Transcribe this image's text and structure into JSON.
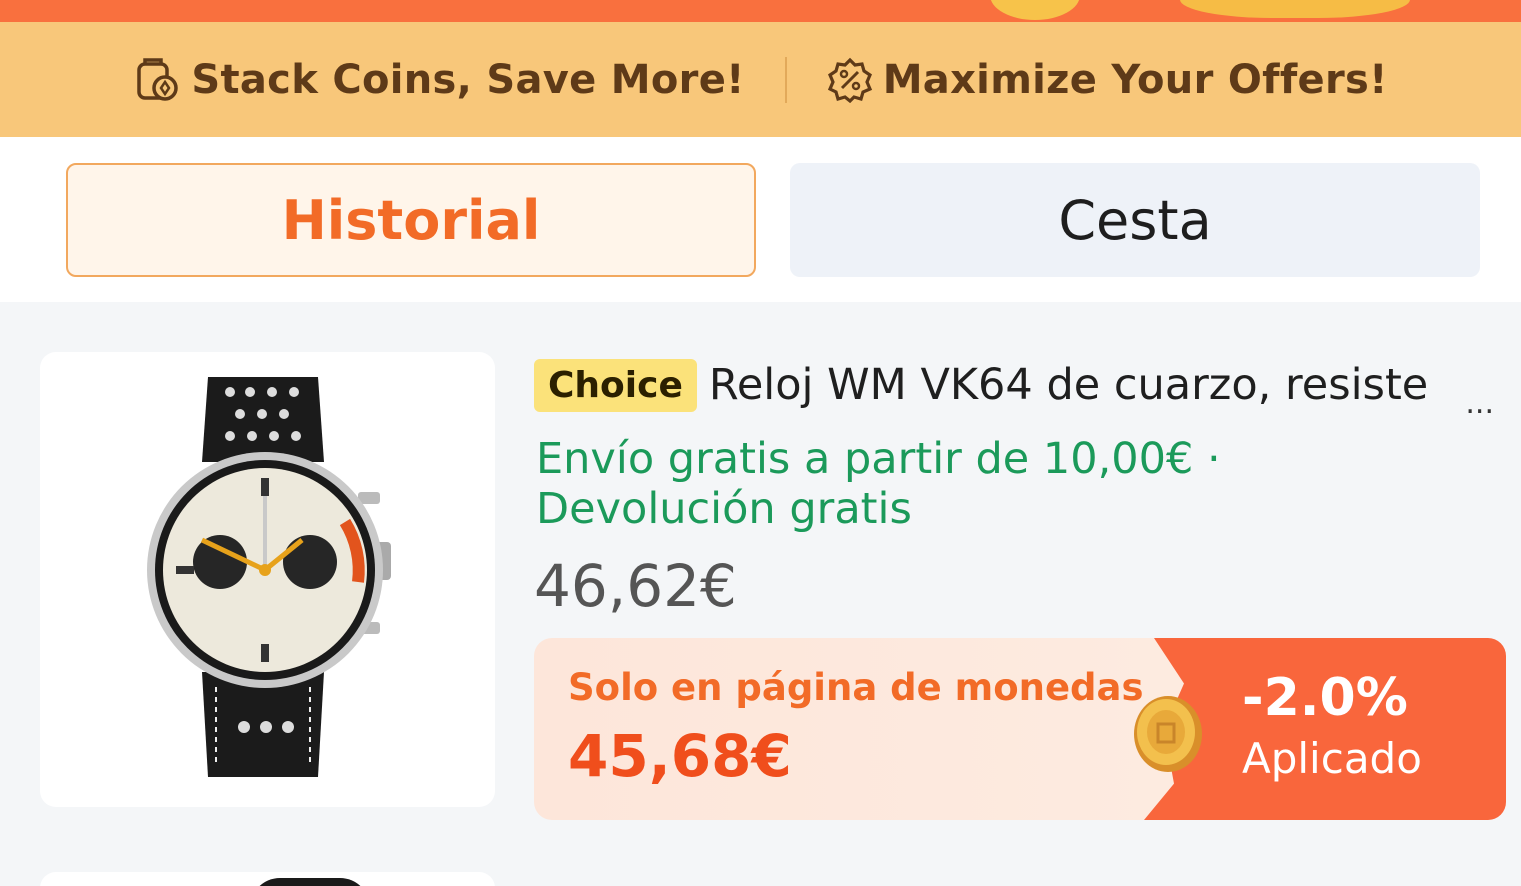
{
  "banner": {
    "left_text": "Stack Coins, Save More!",
    "left_icon": "coin-jar-icon",
    "right_text": "Maximize Your Offers!",
    "right_icon": "percent-badge-icon"
  },
  "tabs": [
    {
      "label": "Historial",
      "active": true
    },
    {
      "label": "Cesta",
      "active": false
    }
  ],
  "product": {
    "badge": "Choice",
    "title": "Reloj WM VK64 de cuarzo, resiste",
    "ellipsis": "...",
    "shipping_line1": "Envío gratis a partir de 10,00€ ·",
    "shipping_line2": "Devolución gratis",
    "price": "46,62€",
    "promo": {
      "label": "Solo en página de monedas",
      "price": "45,68€",
      "discount": "-2.0%",
      "status": "Aplicado"
    }
  },
  "colors": {
    "accent_orange": "#f26b27",
    "shipping_green": "#1b9a5a",
    "banner_bg": "#f8c77a",
    "choice_yellow": "#fbe27a"
  }
}
